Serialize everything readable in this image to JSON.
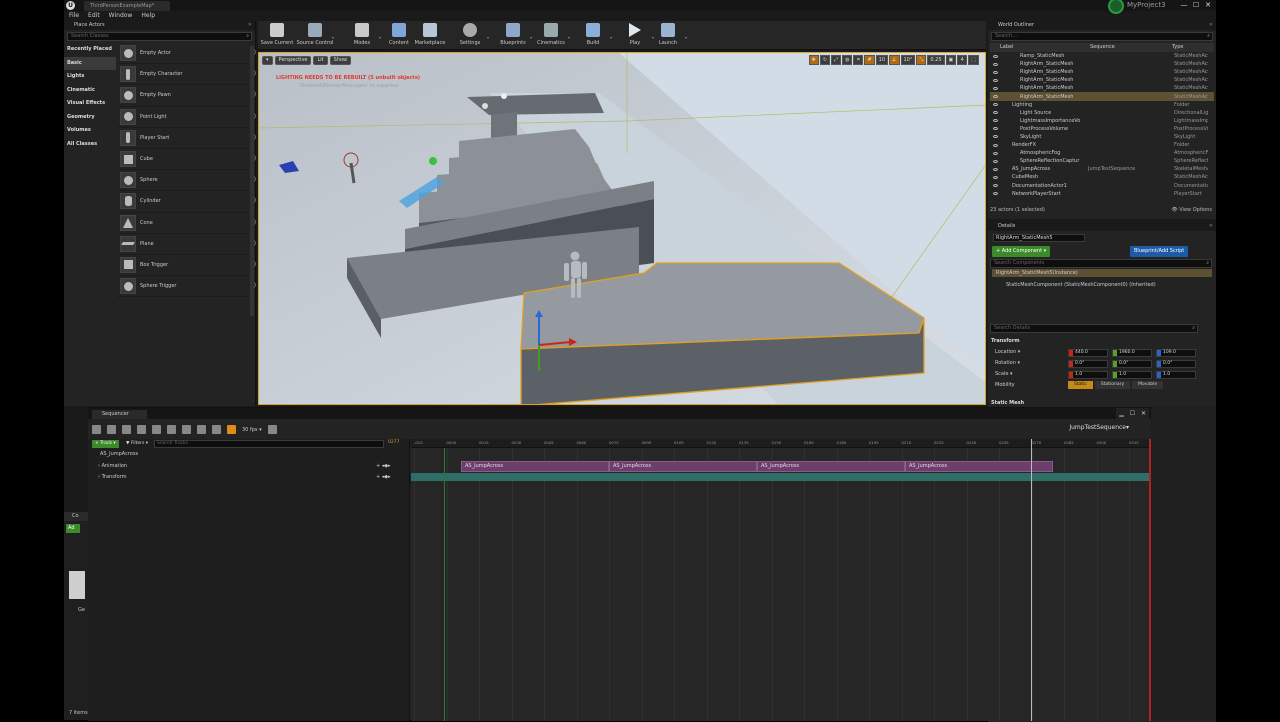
{
  "titlebar": {
    "map_tab": "ThirdPersonExampleMap*",
    "project": "MyProject3",
    "win_min": "—",
    "win_max": "☐",
    "win_close": "✕"
  },
  "menu": [
    "File",
    "Edit",
    "Window",
    "Help"
  ],
  "place_actors": {
    "tab": "Place Actors",
    "search_placeholder": "Search Classes",
    "categories": [
      "Recently Placed",
      "Basic",
      "Lights",
      "Cinematic",
      "Visual Effects",
      "Geometry",
      "Volumes",
      "All Classes"
    ],
    "items": [
      "Empty Actor",
      "Empty Character",
      "Empty Pawn",
      "Point Light",
      "Player Start",
      "Cube",
      "Sphere",
      "Cylinder",
      "Cone",
      "Plane",
      "Box Trigger",
      "Sphere Trigger"
    ]
  },
  "toolbar": {
    "buttons": [
      "Save Current",
      "Source Control",
      "Modes",
      "Content",
      "Marketplace",
      "Settings",
      "Blueprints",
      "Cinematics",
      "Build",
      "Play",
      "Launch"
    ]
  },
  "viewport": {
    "perspective": "Perspective",
    "lit": "Lit",
    "show": "Show",
    "grid": "10",
    "angle": "10°",
    "scale": "0.25",
    "cam": "4",
    "warning": "LIGHTING NEEDS TO BE REBUILT (5 unbuilt objects)",
    "suppress": "'DisableAllScreenMessages' to suppress"
  },
  "outliner": {
    "tab": "World Outliner",
    "search_placeholder": "Search...",
    "col_label": "Label",
    "col_sequence": "Sequence",
    "col_type": "Type",
    "rows": [
      {
        "name": "Ramp_StaticMesh",
        "seq": "",
        "type": "StaticMeshAct",
        "indent": 30
      },
      {
        "name": "RightArm_StaticMesh",
        "seq": "",
        "type": "StaticMeshAct",
        "indent": 30
      },
      {
        "name": "RightArm_StaticMesh",
        "seq": "",
        "type": "StaticMeshAct",
        "indent": 30
      },
      {
        "name": "RightArm_StaticMesh",
        "seq": "",
        "type": "StaticMeshAct",
        "indent": 30
      },
      {
        "name": "RightArm_StaticMesh",
        "seq": "",
        "type": "StaticMeshAct",
        "indent": 30
      },
      {
        "name": "RightArm_StaticMesh",
        "seq": "",
        "type": "StaticMeshAct",
        "indent": 30,
        "sel": true
      },
      {
        "name": "Lighting",
        "seq": "",
        "type": "Folder",
        "indent": 22
      },
      {
        "name": "Light Source",
        "seq": "",
        "type": "DirectionalLigh",
        "indent": 30
      },
      {
        "name": "LightmassImportanceVo",
        "seq": "",
        "type": "LightmassImp",
        "indent": 30
      },
      {
        "name": "PostProcessVolume",
        "seq": "",
        "type": "PostProcessVo",
        "indent": 30
      },
      {
        "name": "SkyLight",
        "seq": "",
        "type": "SkyLight",
        "indent": 30
      },
      {
        "name": "RenderFX",
        "seq": "",
        "type": "Folder",
        "indent": 22
      },
      {
        "name": "AtmosphericFog",
        "seq": "",
        "type": "AtmosphericFo",
        "indent": 30
      },
      {
        "name": "SphereReflectionCaptur",
        "seq": "",
        "type": "SphereReflectio",
        "indent": 30
      },
      {
        "name": "AS_JumpAcross",
        "seq": "JumpTestSequence",
        "type": "SkeletalMeshAct",
        "indent": 22
      },
      {
        "name": "CubeMesh",
        "seq": "",
        "type": "StaticMeshAct",
        "indent": 22
      },
      {
        "name": "DocumentationActor1",
        "seq": "",
        "type": "DocumentationA",
        "indent": 22
      },
      {
        "name": "NetworkPlayerStart",
        "seq": "",
        "type": "PlayerStart",
        "indent": 22
      }
    ],
    "footer": "23 actors (1 selected)",
    "view_options": "👁 View Options"
  },
  "details": {
    "tab": "Details",
    "name": "RightArm_StaticMesh5",
    "add_component": "+ Add Component ▾",
    "blueprint": "Blueprint/Add Script",
    "search_components": "Search Components",
    "comp_instance": "RightArm_StaticMesh5(Instance)",
    "comp_static": "StaticMeshComponent (StaticMeshComponent0) (Inherited)",
    "search_details": "Search Details",
    "transform": "Transform",
    "location_label": "Location ▾",
    "rotation_label": "Rotation ▾",
    "scale_label": "Scale ▾",
    "mobility_label": "Mobility",
    "location": [
      "440.0",
      "1960.0",
      "109.0"
    ],
    "rotation": [
      "0.0°",
      "0.0°",
      "0.0°"
    ],
    "scale": [
      "1.0",
      "1.0",
      "1.0"
    ],
    "mobility": [
      "Static",
      "Stationary",
      "Movable"
    ],
    "static_mesh": "Static Mesh"
  },
  "sequencer": {
    "tab": "Sequencer",
    "track_btn": "+ Track ▾",
    "filters_btn": "▼ Filters ▾",
    "search_placeholder": "Search Tracks",
    "frame": "0277",
    "fps": "30 fps ▾",
    "sequence_name": "JumpTestSequence▾",
    "tracks": [
      "AS_JumpAcross",
      "Animation",
      "Transform"
    ],
    "playhead_label": "0277",
    "clip_label": "AS_JumpAcross",
    "ticks": [
      "-015",
      "0000",
      "0015",
      "0030",
      "0045",
      "0060",
      "0075",
      "0090",
      "0105",
      "0120",
      "0135",
      "0150",
      "0165",
      "0180",
      "0195",
      "0210",
      "0225",
      "0240",
      "0255",
      "0270",
      "0285",
      "0300",
      "0315"
    ]
  },
  "bottom_left": {
    "tab": "Co",
    "add": "Ad",
    "label": "Ge",
    "items": "7 items"
  }
}
